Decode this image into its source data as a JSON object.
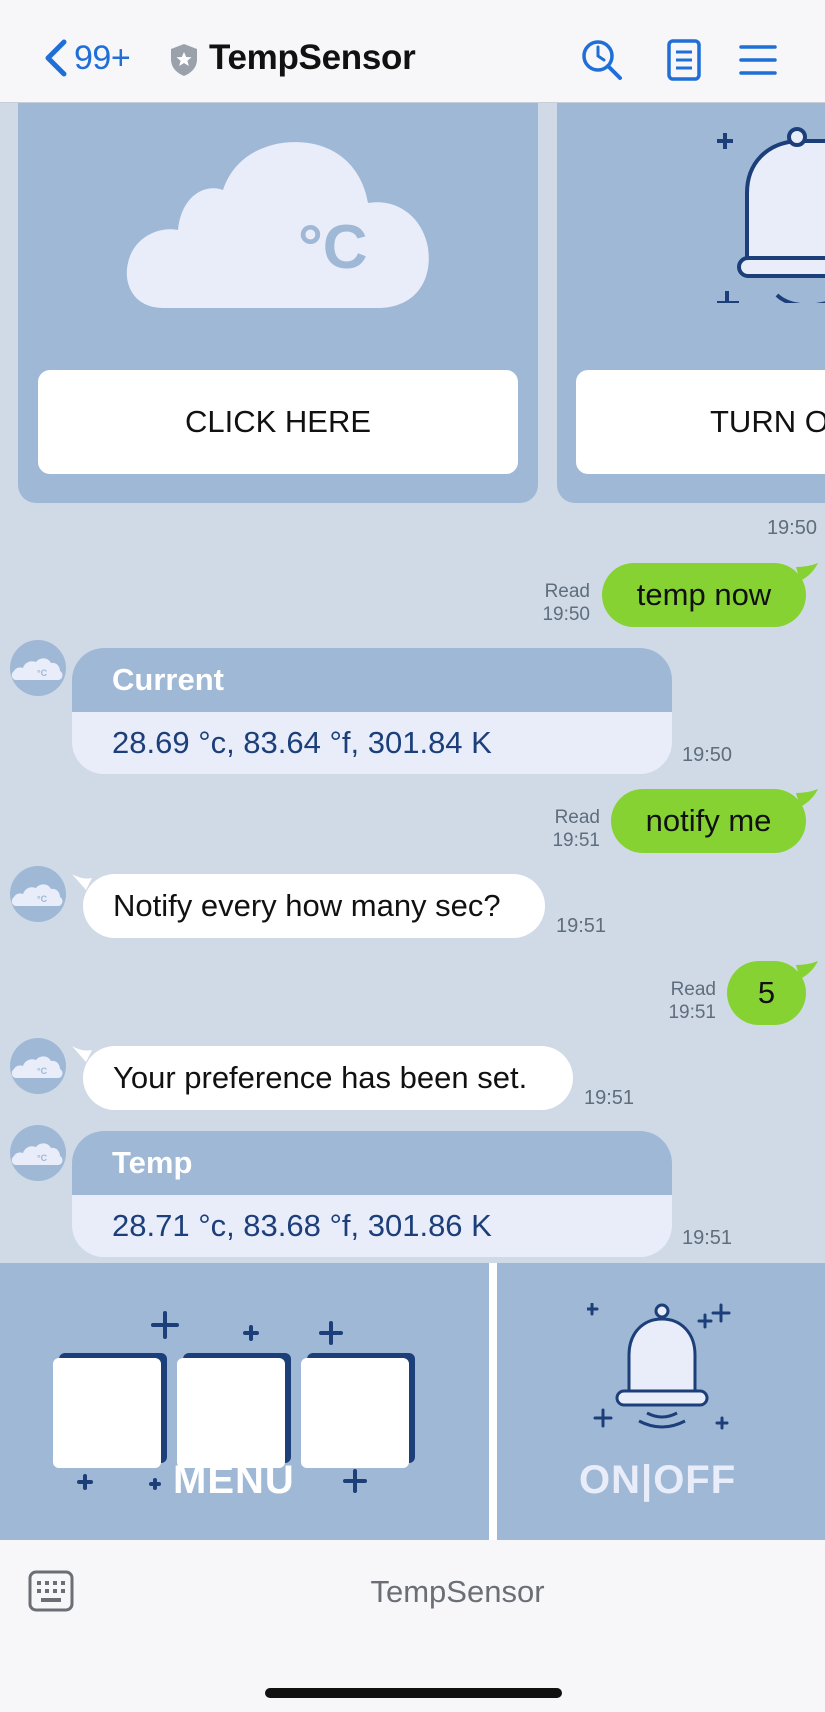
{
  "header": {
    "back_count": "99+",
    "title": "TempSensor",
    "icons": [
      "chevron-left-icon",
      "shield-icon",
      "search-clock-icon",
      "notes-icon",
      "menu-icon"
    ]
  },
  "carousel": [
    {
      "button_label": "CLICK HERE",
      "icon": "cloud-celsius-icon",
      "icon_text": "°C"
    },
    {
      "button_label": "TURN O",
      "icon": "bell-icon"
    }
  ],
  "messages": {
    "carousel_time": "19:50",
    "m1": {
      "text": "temp now",
      "read": "Read",
      "time": "19:50"
    },
    "m2": {
      "title": "Current",
      "body": "28.69 °c, 83.64 °f, 301.84 K",
      "time": "19:50"
    },
    "m3": {
      "text": "notify me",
      "read": "Read",
      "time": "19:51"
    },
    "m4": {
      "text": "Notify every how many sec?",
      "time": "19:51"
    },
    "m5": {
      "text": "5",
      "read": "Read",
      "time": "19:51"
    },
    "m6": {
      "text": "Your preference has been set.",
      "time": "19:51"
    },
    "m7": {
      "title": "Temp",
      "body": "28.71 °c, 83.68 °f, 301.86 K",
      "time": "19:51"
    }
  },
  "rich_menu": {
    "left_label": "MENU",
    "right_label": "ON|OFF"
  },
  "footer": {
    "label": "TempSensor"
  },
  "colors": {
    "accent": "#1f6fd6",
    "outgoing_bubble": "#86d233",
    "card": "#9fb8d6",
    "chat_bg": "#cfdae6",
    "info_text": "#1c3f7a"
  }
}
